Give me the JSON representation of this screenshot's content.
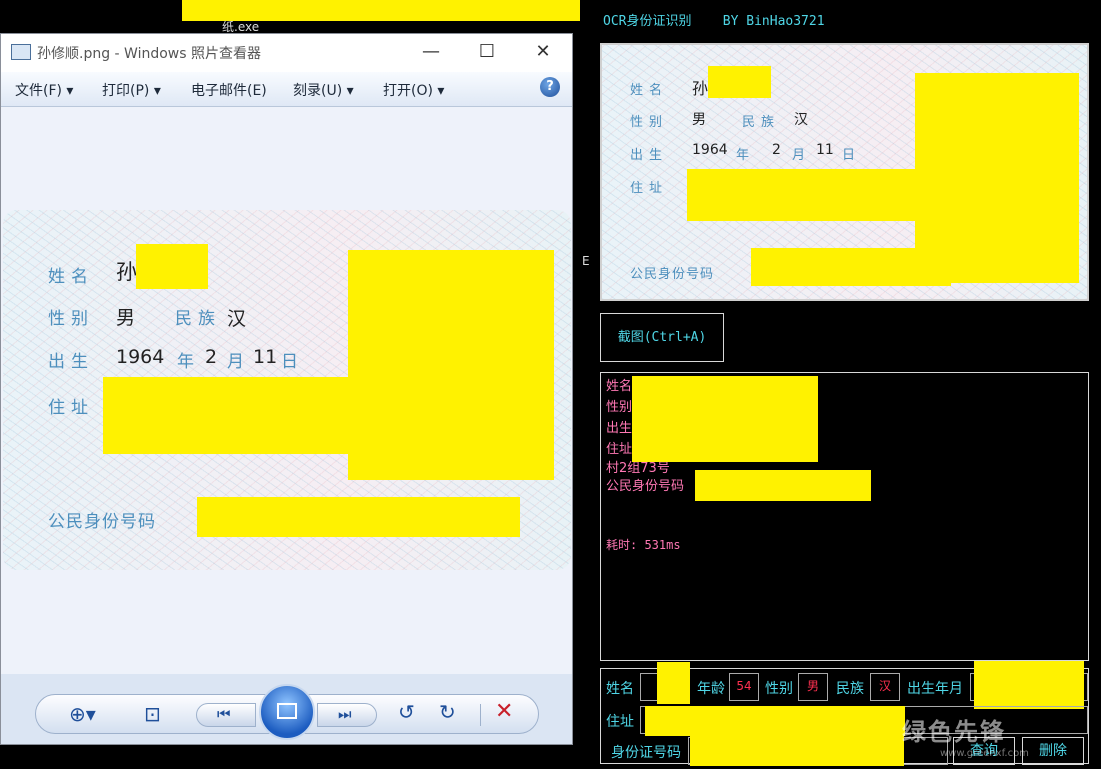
{
  "taskbar": {
    "exe_label": "纸.exe"
  },
  "viewer": {
    "title": "孙修顺.png - Windows 照片查看器",
    "caption_buttons": [
      "—",
      "☐",
      "✕"
    ],
    "menu": [
      "文件(F) ▾",
      "打印(P) ▾",
      "电子邮件(E)",
      "刻录(U) ▾",
      "打开(O) ▾"
    ],
    "help": "?"
  },
  "card": {
    "name_label": "姓名",
    "name_value": "孙",
    "sex_label": "性别",
    "sex_value": "男",
    "ethnic_label": "民族",
    "ethnic_value": "汉",
    "birth_label": "出生",
    "birth_year": "1964",
    "year_label": "年",
    "birth_month": "2",
    "month_label": "月",
    "birth_day": "11",
    "day_label": "日",
    "address_label": "住址",
    "id_label": "公民身份号码"
  },
  "ocr": {
    "title": "OCR身份证识别    BY BinHao3721",
    "capture_button": "截图(Ctrl+A)",
    "result_lines": [
      "姓名",
      "性别",
      "出生",
      "住址",
      "村2组73号",
      "公民身份号码"
    ],
    "elapsed": "耗时: 531ms",
    "form": {
      "name_label": "姓名",
      "age_label": "年龄",
      "age_value": "54",
      "sex_label": "性别",
      "sex_value": "男",
      "ethnic_label": "民族",
      "ethnic_value": "汉",
      "birth_label": "出生年月",
      "address_label": "住址",
      "id_label": "身份证号码",
      "query_button": "查询",
      "delete_button": "删除"
    },
    "side_letter": "E"
  },
  "watermark": {
    "text": "绿色先锋",
    "url": "www.greenxf.com"
  }
}
